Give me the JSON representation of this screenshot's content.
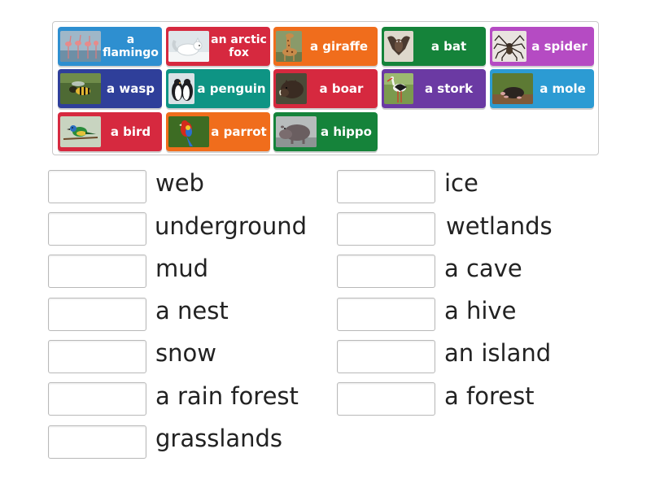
{
  "tiles": [
    {
      "label": "a flamingo",
      "color": "#2e8fd0",
      "icon": "flamingo-icon"
    },
    {
      "label": "an arctic fox",
      "color": "#d6293f",
      "icon": "arctic-fox-icon"
    },
    {
      "label": "a giraffe",
      "color": "#f06d1c",
      "icon": "giraffe-icon"
    },
    {
      "label": "a bat",
      "color": "#15833a",
      "icon": "bat-icon"
    },
    {
      "label": "a spider",
      "color": "#b54bc3",
      "icon": "spider-icon"
    },
    {
      "label": "a wasp",
      "color": "#2f3f9a",
      "icon": "wasp-icon"
    },
    {
      "label": "a penguin",
      "color": "#0e9484",
      "icon": "penguin-icon"
    },
    {
      "label": "a boar",
      "color": "#d6293f",
      "icon": "boar-icon"
    },
    {
      "label": "a stork",
      "color": "#6b3aa3",
      "icon": "stork-icon"
    },
    {
      "label": "a mole",
      "color": "#2c9bd3",
      "icon": "mole-icon"
    },
    {
      "label": "a bird",
      "color": "#d6293f",
      "icon": "bird-icon"
    },
    {
      "label": "a parrot",
      "color": "#f06d1c",
      "icon": "parrot-icon"
    },
    {
      "label": "a hippo",
      "color": "#15833a",
      "icon": "hippo-icon"
    }
  ],
  "places_left": [
    "web",
    "underground",
    "mud",
    "a nest",
    "snow",
    "a rain forest",
    "grasslands"
  ],
  "places_right": [
    "ice",
    "wetlands",
    "a cave",
    "a hive",
    "an island",
    "a forest"
  ]
}
